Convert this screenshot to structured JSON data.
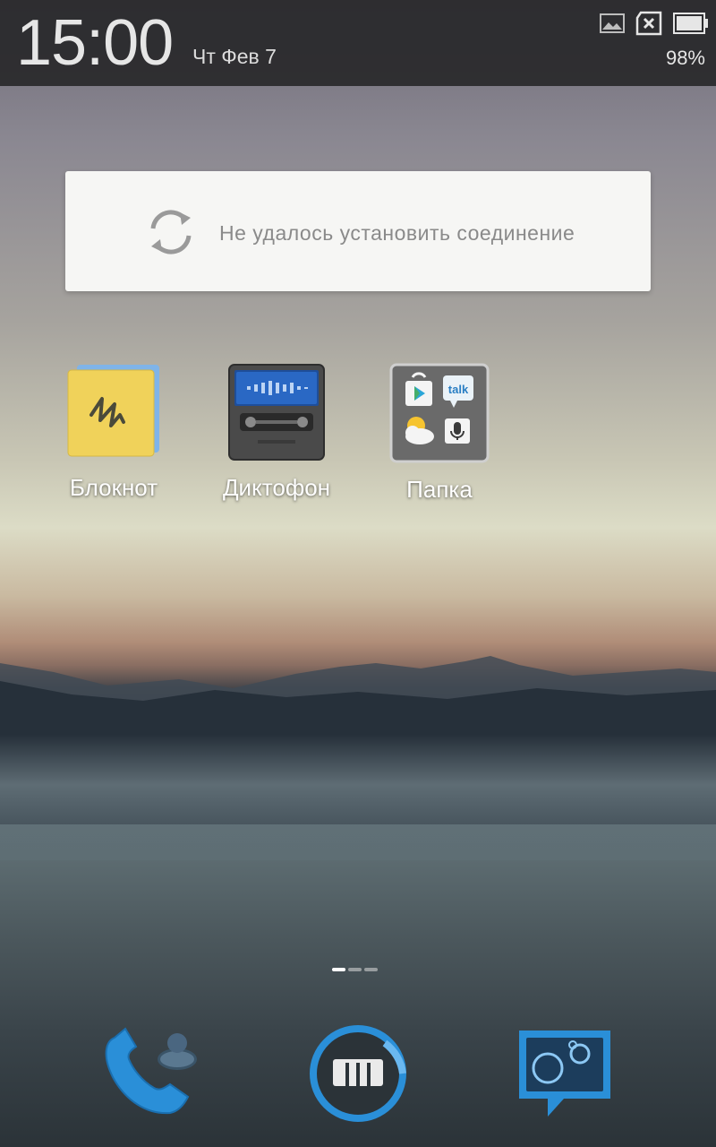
{
  "status_bar": {
    "time": "15:00",
    "date": "Чт Фев 7",
    "battery_percent": "98%",
    "icons": [
      "gallery-icon",
      "sim-missing-icon",
      "battery-icon"
    ]
  },
  "widget": {
    "message": "Не удалось установить соединение",
    "icon": "sync-icon"
  },
  "apps": [
    {
      "label": "Блокнот",
      "icon": "notes-icon"
    },
    {
      "label": "Диктофон",
      "icon": "voice-recorder-icon"
    },
    {
      "label": "Папка",
      "icon": "folder-icon",
      "contents": [
        "play-store-icon",
        "talk-icon",
        "weather-icon",
        "voice-search-icon"
      ]
    }
  ],
  "folder_contents": {
    "talk_text": "talk"
  },
  "page_indicator": {
    "pages": 3,
    "active": 1
  },
  "dock": [
    {
      "icon": "phone-contacts-icon"
    },
    {
      "icon": "app-drawer-icon"
    },
    {
      "icon": "messages-icon"
    }
  ],
  "colors": {
    "accent": "#2a8fd8",
    "status_bar": "#28282a",
    "note_yellow": "#f0d25a"
  }
}
